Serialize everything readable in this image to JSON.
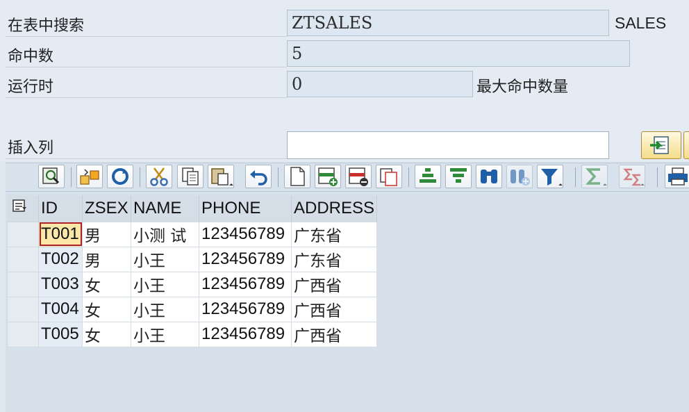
{
  "form": {
    "search_label": "在表中搜索",
    "search_value": "ZTSALES",
    "search_desc": "SALES",
    "hits_label": "命中数",
    "hits_value": "5",
    "runtime_label": "运行时",
    "runtime_value": "0",
    "max_hits_label": "最大命中数量",
    "insert_col_label": "插入列",
    "insert_col_value": ""
  },
  "toolbar": {
    "icons": [
      "details-icon",
      "subtotal-icon",
      "refresh-icon",
      "cut-icon",
      "copy-icon",
      "paste-icon",
      "undo-icon",
      "append-row-icon",
      "insert-row-icon",
      "delete-row-icon",
      "duplicate-row-icon",
      "sort-ascending-icon",
      "sort-descending-icon",
      "find-icon",
      "find-next-icon",
      "filter-icon",
      "sum-icon",
      "subtotals-icon",
      "print-icon"
    ]
  },
  "grid": {
    "columns": [
      "ID",
      "ZSEX",
      "NAME",
      "PHONE",
      "ADDRESS"
    ],
    "rows": [
      {
        "id": "T001",
        "zsex": "男",
        "name": "小测 试",
        "phone": "123456789",
        "address": "广东省"
      },
      {
        "id": "T002",
        "zsex": "男",
        "name": "小王",
        "phone": "123456789",
        "address": "广东省"
      },
      {
        "id": "T003",
        "zsex": "女",
        "name": "小王",
        "phone": "123456789",
        "address": "广西省"
      },
      {
        "id": "T004",
        "zsex": "女",
        "name": "小王",
        "phone": "123456789",
        "address": "广西省"
      },
      {
        "id": "T005",
        "zsex": "女",
        "name": "小王",
        "phone": "123456789",
        "address": "广西省"
      }
    ]
  }
}
